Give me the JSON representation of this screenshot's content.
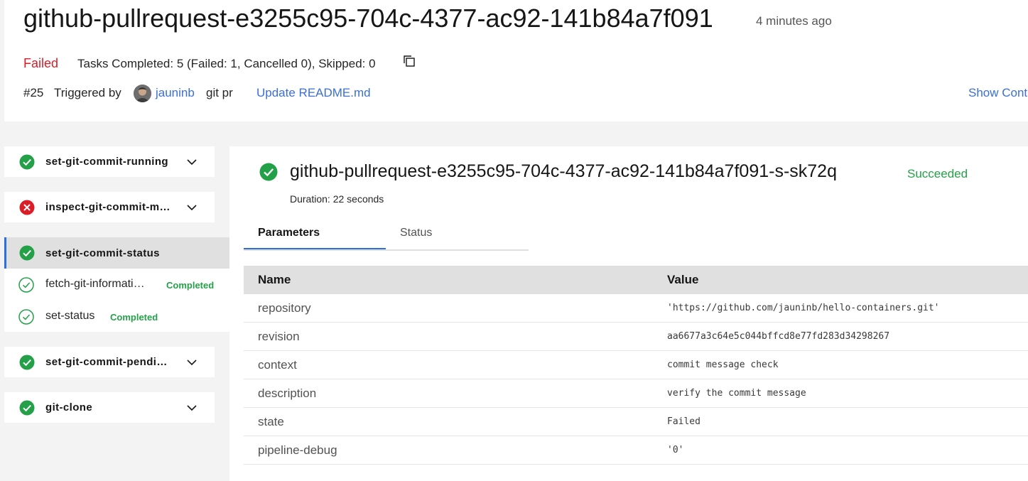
{
  "header": {
    "title": "github-pullrequest-e3255c95-704c-4377-ac92-141b84a7f091",
    "age": "4 minutes ago",
    "status": "Failed",
    "tasks_summary": "Tasks Completed: 5 (Failed: 1, Cancelled 0), Skipped: 0",
    "run_number": "#25",
    "triggered_label": "Triggered by",
    "trigger_user": "jauninb",
    "trigger_source": "git pr",
    "commit_message": "Update README.md",
    "show_context": "Show Context"
  },
  "sidebar": {
    "tasks": [
      {
        "name": "set-git-commit-running",
        "status": "succeeded"
      },
      {
        "name": "inspect-git-commit-m…",
        "status": "failed"
      },
      {
        "name": "set-git-commit-status",
        "status": "succeeded",
        "selected": true,
        "steps": [
          {
            "name": "fetch-git-informati…",
            "badge": "Completed"
          },
          {
            "name": "set-status",
            "badge": "Completed"
          }
        ]
      },
      {
        "name": "set-git-commit-pendi…",
        "status": "succeeded"
      },
      {
        "name": "git-clone",
        "status": "succeeded"
      }
    ]
  },
  "detail": {
    "title": "github-pullrequest-e3255c95-704c-4377-ac92-141b84a7f091-s-sk72q",
    "status": "Succeeded",
    "duration": "Duration: 22 seconds",
    "tabs": [
      "Parameters",
      "Status"
    ],
    "active_tab": "Parameters",
    "params": {
      "headers": [
        "Name",
        "Value"
      ],
      "rows": [
        {
          "name": "repository",
          "value": "'https://github.com/jauninb/hello-containers.git'"
        },
        {
          "name": "revision",
          "value": "aa6677a3c64e5c044bffcd8e77fd283d34298267"
        },
        {
          "name": "context",
          "value": "commit message check"
        },
        {
          "name": "description",
          "value": "verify the commit message"
        },
        {
          "name": "state",
          "value": "Failed"
        },
        {
          "name": "pipeline-debug",
          "value": "'0'"
        }
      ]
    }
  },
  "colors": {
    "success": "#24a148",
    "failure": "#da1e28",
    "link": "#3b6fd8",
    "accent": "#2f6fdc"
  }
}
